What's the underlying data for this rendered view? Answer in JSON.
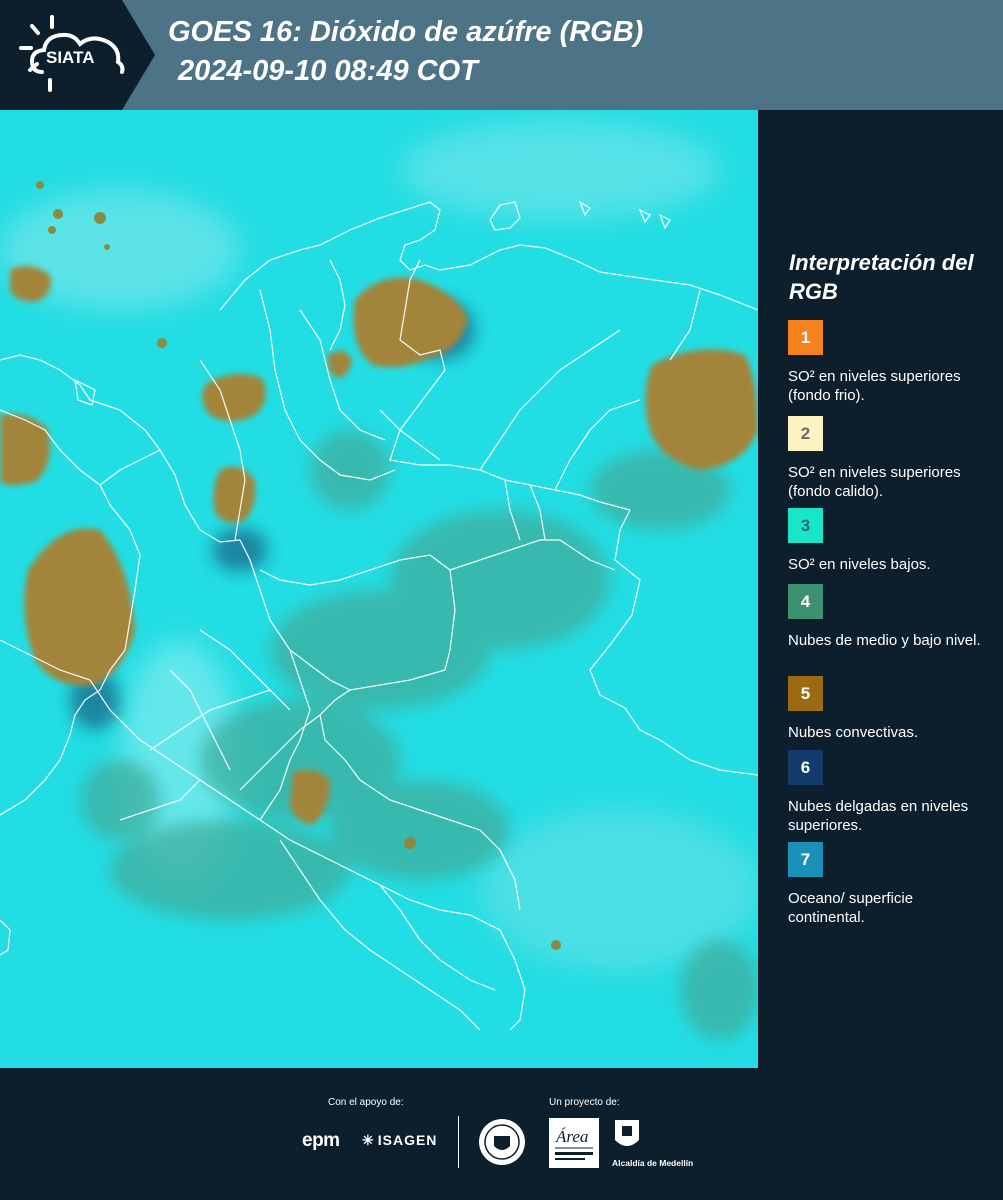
{
  "header": {
    "logo_text": "SIATA",
    "title_line1": "GOES 16: Dióxido de azúfre (RGB)",
    "title_line2": "2024-09-10 08:49 COT"
  },
  "legend": {
    "title": "Interpretación del RGB",
    "items": [
      {
        "number": "1",
        "label": "SO² en niveles superiores (fondo frio).",
        "color": "#f5821f",
        "text_color": "#ffffff"
      },
      {
        "number": "2",
        "label": "SO² en niveles superiores (fondo calido).",
        "color": "#fdf3c0",
        "text_color": "#6b6b6b"
      },
      {
        "number": "3",
        "label": "SO² en niveles bajos.",
        "color": "#19e6c9",
        "text_color": "#2b6b6b"
      },
      {
        "number": "4",
        "label": "Nubes de medio y bajo nivel.",
        "color": "#3d9170",
        "text_color": "#ffffff"
      },
      {
        "number": "5",
        "label": "Nubes convectivas.",
        "color": "#9b6a12",
        "text_color": "#ffffff"
      },
      {
        "number": "6",
        "label": "Nubes delgadas en niveles superiores.",
        "color": "#123a6b",
        "text_color": "#ffffff"
      },
      {
        "number": "7",
        "label": "Oceano/ superficie continental.",
        "color": "#1a8fb8",
        "text_color": "#ffffff"
      }
    ]
  },
  "footer": {
    "support_label": "Con el apoyo de:",
    "project_label": "Un proyecto de:",
    "sponsors": [
      "epm",
      "ISAGEN"
    ],
    "partners": [
      "Área Metropolitana Valle de Aburrá",
      "Alcaldía de Medellín"
    ],
    "alcaldia_label": "Alcaldía de Medellín"
  },
  "map": {
    "background_color": "#22dde3",
    "convective_color": "#a3843a",
    "low_cloud_color": "#3aa39a",
    "border_color": "#ffffff"
  }
}
